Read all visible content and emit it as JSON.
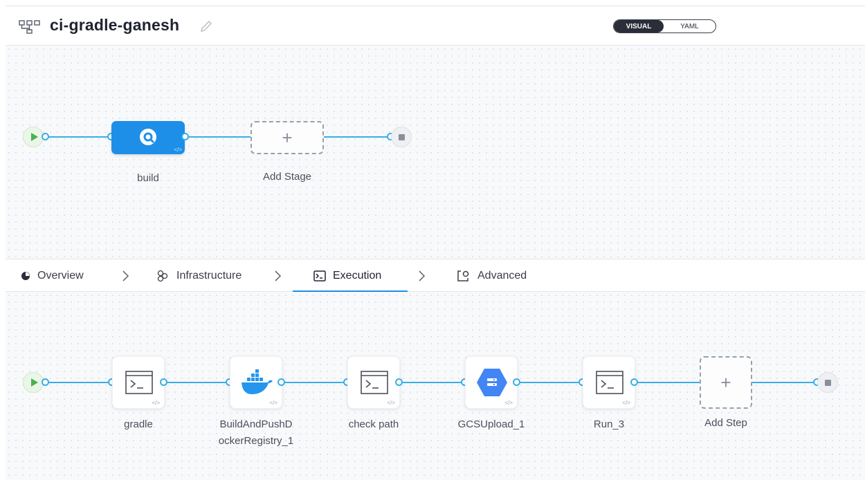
{
  "header": {
    "pipeline_name": "ci-gradle-ganesh",
    "toggle": {
      "visual_label": "VISUAL",
      "yaml_label": "YAML",
      "selected": "VISUAL"
    }
  },
  "stages": {
    "items": [
      {
        "label": "build",
        "icon": "ci-stage-icon"
      }
    ],
    "add_label": "Add Stage"
  },
  "tabs": {
    "items": [
      {
        "label": "Overview",
        "icon": "overview-icon"
      },
      {
        "label": "Infrastructure",
        "icon": "infrastructure-icon"
      },
      {
        "label": "Execution",
        "icon": "execution-icon"
      },
      {
        "label": "Advanced",
        "icon": "advanced-icon"
      }
    ],
    "active": "Execution"
  },
  "steps": {
    "items": [
      {
        "label": "gradle",
        "icon": "terminal-icon"
      },
      {
        "label": "BuildAndPushDockerRegistry_1",
        "label_line1": "BuildAndPushD",
        "label_line2": "ockerRegistry_1",
        "icon": "docker-icon"
      },
      {
        "label": "check path",
        "icon": "terminal-icon"
      },
      {
        "label": "GCSUpload_1",
        "icon": "gcs-icon"
      },
      {
        "label": "Run_3",
        "icon": "terminal-icon"
      }
    ],
    "add_label": "Add Step"
  },
  "colors": {
    "accent": "#1d8fe8",
    "connector": "#38aee6",
    "start": "#4caf50",
    "gcs": "#4285f4",
    "docker": "#2496ed"
  }
}
